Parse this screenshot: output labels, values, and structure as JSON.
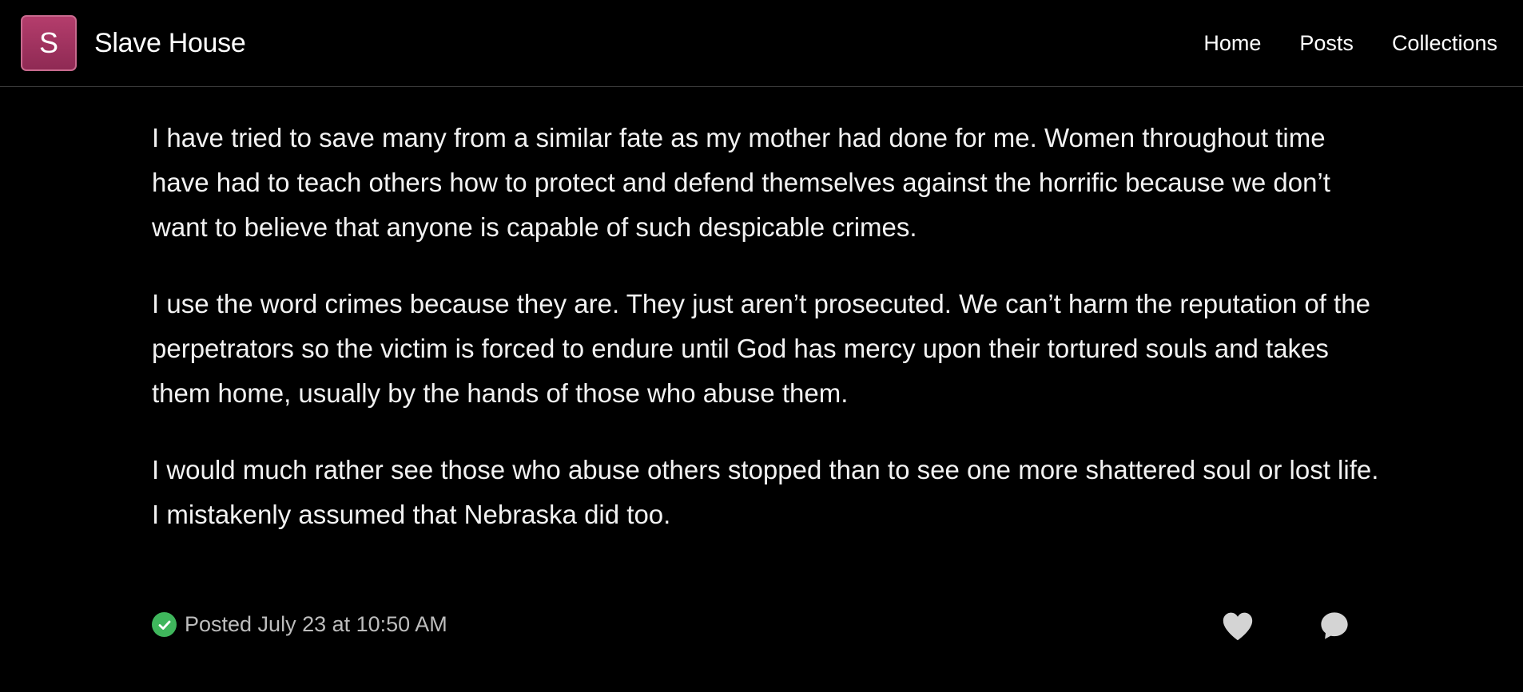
{
  "header": {
    "logo_letter": "S",
    "site_title": "Slave House",
    "nav": [
      {
        "label": "Home"
      },
      {
        "label": "Posts"
      },
      {
        "label": "Collections"
      }
    ]
  },
  "post": {
    "paragraphs": [
      "I have tried to save many from a similar fate as my mother had done for me. Women throughout time have had to teach others how to protect and defend themselves against the horrific because we don’t want to believe that anyone is capable of such despicable crimes.",
      "I use the word crimes because they are. They just aren’t prosecuted. We can’t harm the reputation of the perpetrators so the victim is forced to endure until God has mercy upon their tortured souls and takes them home, usually by the hands of those who abuse them.",
      "I would much rather see those who abuse others stopped than to see one more shattered soul or lost life. I mistakenly assumed that Nebraska did too."
    ],
    "posted_text": "Posted July 23 at 10:50 AM",
    "status_icon": "check-circle-icon",
    "actions": [
      {
        "icon": "heart-icon"
      },
      {
        "icon": "comment-icon"
      }
    ]
  },
  "colors": {
    "background": "#000000",
    "logo_accent": "#9e3360",
    "check_green": "#3fb65c",
    "icon_gray": "#d4d4d4"
  }
}
